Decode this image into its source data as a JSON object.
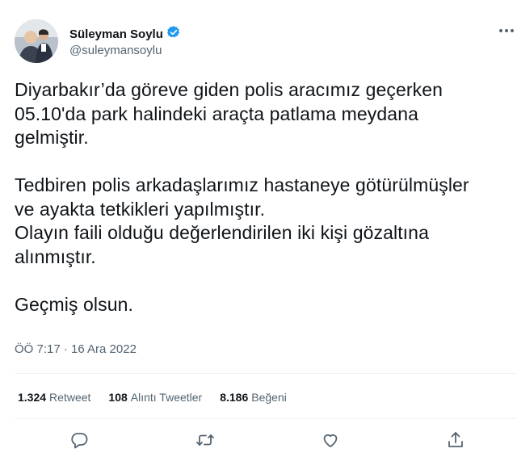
{
  "author": {
    "name": "Süleyman Soylu",
    "handle": "@suleymansoylu",
    "verified_icon": "verified-badge-icon",
    "accent_color": "#1d9bf0"
  },
  "tweet": {
    "paragraphs": [
      [
        "Diyarbakır’da göreve giden polis aracımız geçerken",
        "05.10'da park halindeki araçta patlama meydana",
        "gelmiştir."
      ],
      [
        "Tedbiren polis arkadaşlarımız hastaneye götürülmüşler",
        "ve ayakta tetkikleri yapılmıştır.",
        "Olayın faili olduğu değerlendirilen iki kişi gözaltına",
        "alınmıştır."
      ],
      [
        "Geçmiş olsun."
      ]
    ],
    "timestamp": "ÖÖ 7:17 · 16 Ara 2022"
  },
  "stats": {
    "retweets_count": "1.324",
    "retweets_label": "Retweet",
    "quotes_count": "108",
    "quotes_label": "Alıntı Tweetler",
    "likes_count": "8.186",
    "likes_label": "Beğeni"
  },
  "actions": [
    "reply-icon",
    "retweet-icon",
    "like-icon",
    "share-icon"
  ],
  "colors": {
    "text": "#0f1419",
    "secondary": "#536471",
    "divider": "#eff3f4"
  }
}
